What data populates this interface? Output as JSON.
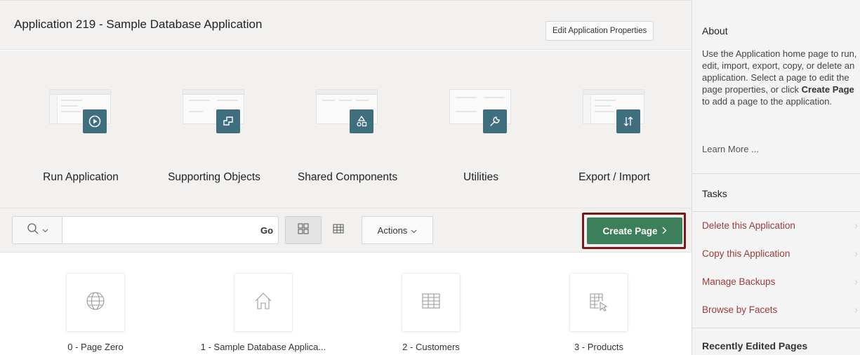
{
  "header": {
    "title": "Application 219 - Sample Database Application",
    "edit_label": "Edit Application Properties"
  },
  "tiles": [
    {
      "label": "Run Application",
      "icon": "run-icon"
    },
    {
      "label": "Supporting Objects",
      "icon": "supporting-objects-icon"
    },
    {
      "label": "Shared Components",
      "icon": "shared-components-icon"
    },
    {
      "label": "Utilities",
      "icon": "wrench-icon"
    },
    {
      "label": "Export / Import",
      "icon": "export-import-icon"
    }
  ],
  "toolbar": {
    "search_placeholder": "",
    "go_label": "Go",
    "actions_label": "Actions",
    "create_label": "Create Page"
  },
  "pages": [
    {
      "label": "0 - Page Zero",
      "icon": "globe-icon"
    },
    {
      "label": "1 - Sample Database Applica...",
      "icon": "home-icon"
    },
    {
      "label": "2 - Customers",
      "icon": "table-icon"
    },
    {
      "label": "3 - Products",
      "icon": "table-cursor-icon"
    }
  ],
  "side": {
    "about_title": "About",
    "about_text_a": "Use the Application home page to run, edit, import, export, copy, or delete an application. Select a page to edit the page properties, or click ",
    "about_text_bold": "Create Page",
    "about_text_b": " to add a page to the application.",
    "learn_more": "Learn More ...",
    "tasks_title": "Tasks",
    "tasks": [
      "Delete this Application",
      "Copy this Application",
      "Manage Backups",
      "Browse by Facets"
    ],
    "recent_title": "Recently Edited Pages"
  },
  "colors": {
    "badge": "#3f6f7e",
    "create_button": "#3c7f5a",
    "highlight_outline": "#7a1a1a",
    "task_link": "#9b3b3b"
  }
}
